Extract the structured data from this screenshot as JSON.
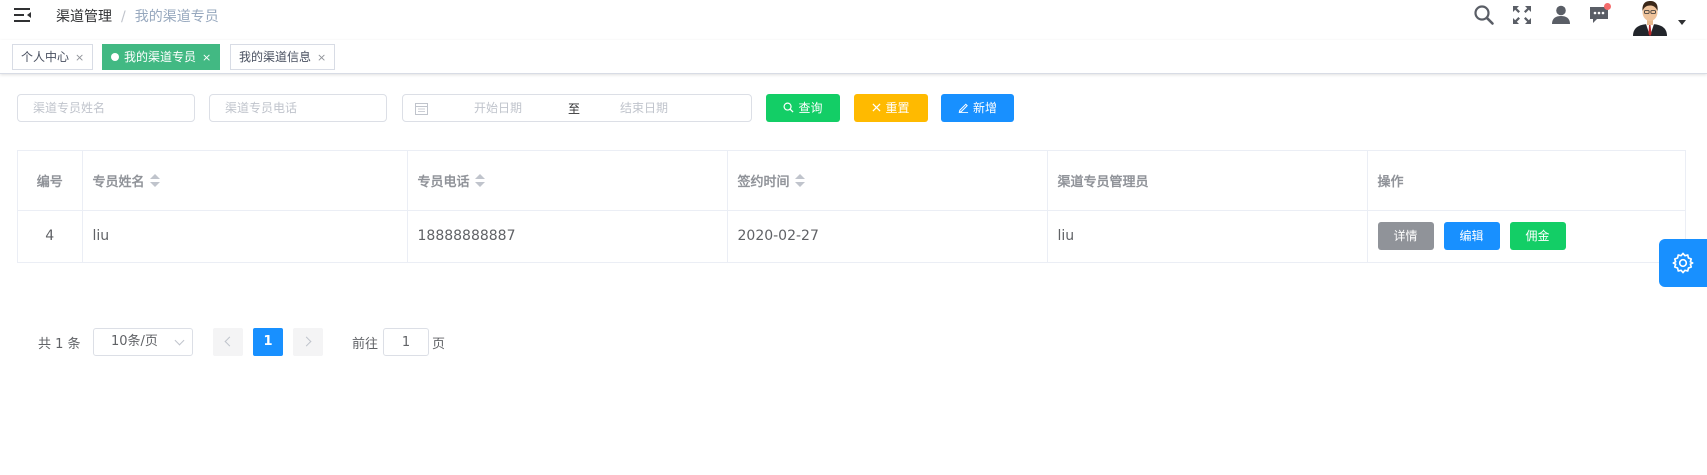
{
  "breadcrumb": {
    "first": "渠道管理",
    "separator": "/",
    "current": "我的渠道专员"
  },
  "tags": [
    {
      "label": "个人中心",
      "active": false
    },
    {
      "label": "我的渠道专员",
      "active": true
    },
    {
      "label": "我的渠道信息",
      "active": false
    }
  ],
  "tag_close_glyph": "×",
  "filters": {
    "name_placeholder": "渠道专员姓名",
    "phone_placeholder": "渠道专员电话",
    "start_placeholder": "开始日期",
    "range_separator": "至",
    "end_placeholder": "结束日期"
  },
  "buttons": {
    "search": "查询",
    "reset": "重置",
    "add": "新增"
  },
  "table": {
    "headers": [
      "编号",
      "专员姓名",
      "专员电话",
      "签约时间",
      "渠道专员管理员",
      "操作"
    ],
    "rows": [
      {
        "id": "4",
        "name": "liu",
        "phone": "18888888887",
        "sign_date": "2020-02-27",
        "manager": "liu"
      }
    ],
    "actions": {
      "detail": "详情",
      "edit": "编辑",
      "commission": "佣金"
    }
  },
  "pagination": {
    "total_text": "共 1 条",
    "page_size": "10条/页",
    "current_page": "1",
    "goto_prefix": "前往",
    "goto_value": "1",
    "goto_suffix": "页"
  },
  "colors": {
    "active_tag": "#42b983",
    "primary": "#1890ff",
    "success": "#13ce66",
    "warning": "#ffba00",
    "info": "#909399",
    "notify_dot": "#f56c6c"
  },
  "icons": [
    "hamburger-icon",
    "search-icon",
    "fullscreen-icon",
    "user-icon",
    "message-icon",
    "avatar",
    "calendar-icon",
    "settings-gear-icon"
  ]
}
